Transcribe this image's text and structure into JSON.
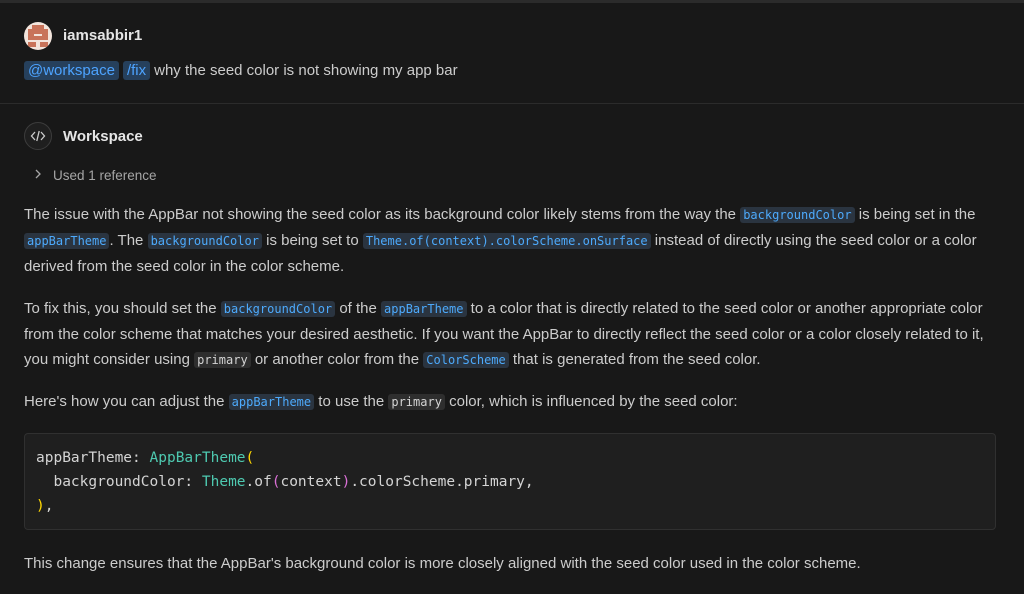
{
  "request": {
    "username": "iamsabbir1",
    "agent": "@workspace",
    "command": "/fix",
    "message": "why the seed color is not showing my app bar"
  },
  "response": {
    "author": "Workspace",
    "references_label": "Used 1 reference",
    "p1": [
      "The issue with the AppBar not showing the seed color as its background color likely stems from the way the ",
      "backgroundColor",
      " is being set in the ",
      "appBarTheme",
      ". The ",
      "backgroundColor",
      " is being set to ",
      "Theme.of(context).colorScheme.onSurface",
      " instead of directly using the seed color or a color derived from the seed color in the color scheme."
    ],
    "p2": [
      "To fix this, you should set the ",
      "backgroundColor",
      " of the ",
      "appBarTheme",
      " to a color that is directly related to the seed color or another appropriate color from the color scheme that matches your desired aesthetic. If you want the AppBar to directly reflect the seed color or a color closely related to it, you might consider using ",
      "primary",
      " or another color from the ",
      "ColorScheme",
      " that is generated from the seed color."
    ],
    "p3": [
      "Here's how you can adjust the ",
      "appBarTheme",
      " to use the ",
      "primary",
      " color, which is influenced by the seed color:"
    ],
    "code": {
      "l1_key": "appBarTheme: ",
      "l1_type": "AppBarTheme",
      "l1_paren": "(",
      "l2_key": "  backgroundColor: ",
      "l2_type": "Theme",
      "l2_dot": ".of",
      "l2_open": "(",
      "l2_arg": "context",
      "l2_close": ")",
      "l2_rest": ".colorScheme.primary,",
      "l3_paren": ")",
      "l3_rest": ","
    },
    "conclusion": "This change ensures that the AppBar's background color is more closely aligned with the seed color used in the color scheme."
  }
}
